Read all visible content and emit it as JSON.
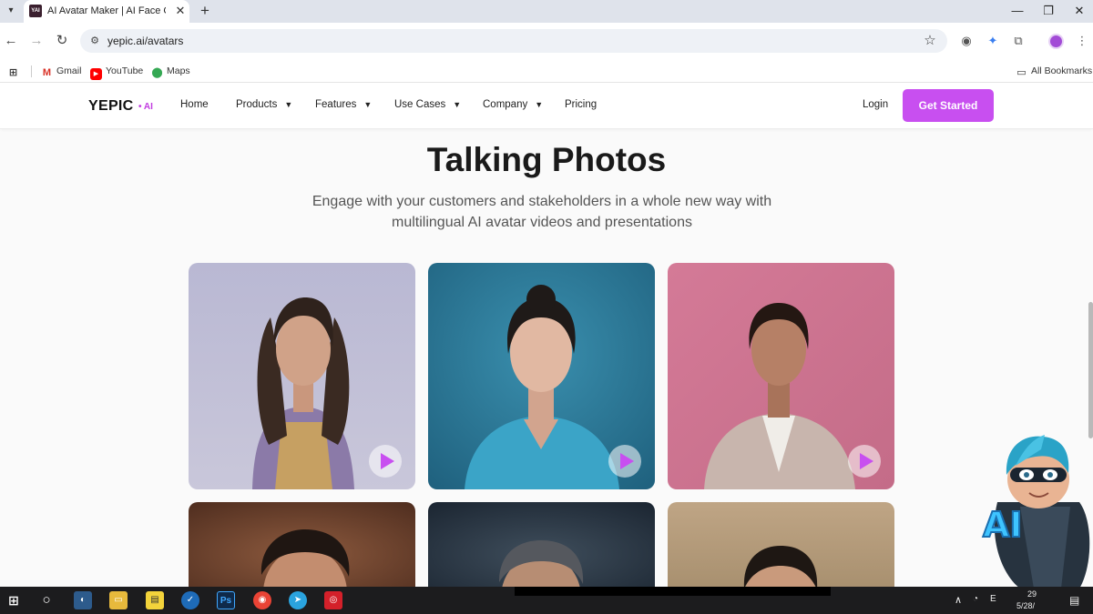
{
  "browser": {
    "tab_title": "AI Avatar Maker | AI Face Generator",
    "favicon_text": "YAI",
    "url": "yepic.ai/avatars",
    "bookmarks": [
      "Gmail",
      "YouTube",
      "Maps"
    ],
    "all_bookmarks": "All Bookmarks"
  },
  "header": {
    "logo": "YEPIC",
    "logo_suffix": "• AI",
    "nav": [
      "Home",
      "Products",
      "Features",
      "Use Cases",
      "Company",
      "Pricing"
    ],
    "login": "Login",
    "cta": "Get Started"
  },
  "hero": {
    "title": "Talking Photos",
    "subtitle": "Engage with your customers and stakeholders in a whole new way with multilingual AI avatar videos and presentations"
  },
  "mascot": {
    "badge": "AI"
  },
  "taskbar": {
    "tray_time": "29",
    "tray_date": "5/28/",
    "tray_lang": "E"
  },
  "colors": {
    "accent": "#c84ff0",
    "logo_ai": "#c13de0"
  }
}
